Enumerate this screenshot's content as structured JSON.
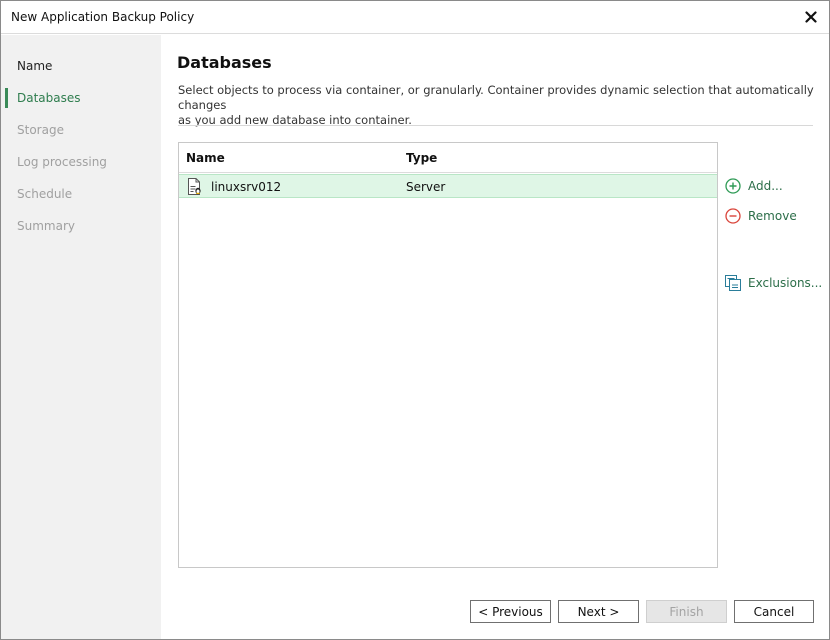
{
  "window": {
    "title": "New Application Backup Policy"
  },
  "steps": [
    {
      "label": "Name",
      "state": "done"
    },
    {
      "label": "Databases",
      "state": "active"
    },
    {
      "label": "Storage",
      "state": "pending"
    },
    {
      "label": "Log processing",
      "state": "pending"
    },
    {
      "label": "Schedule",
      "state": "pending"
    },
    {
      "label": "Summary",
      "state": "pending"
    }
  ],
  "main": {
    "heading": "Databases",
    "description_line1": "Select objects to process via container, or granularly. Container provides dynamic selection that automatically changes",
    "description_line2": "as you add new database into container."
  },
  "table": {
    "columns": [
      "Name",
      "Type"
    ],
    "rows": [
      {
        "name": "linuxsrv012",
        "type": "Server",
        "icon": "linux-server-icon"
      }
    ]
  },
  "actions": {
    "add": "Add...",
    "remove": "Remove",
    "exclusions": "Exclusions..."
  },
  "buttons": {
    "previous": "< Previous",
    "next": "Next >",
    "finish": "Finish",
    "cancel": "Cancel"
  },
  "colors": {
    "accent": "#2e7d4e",
    "selected_row": "#dff6e6",
    "sidebar_bg": "#f1f1f1",
    "remove_icon": "#d9443a"
  }
}
